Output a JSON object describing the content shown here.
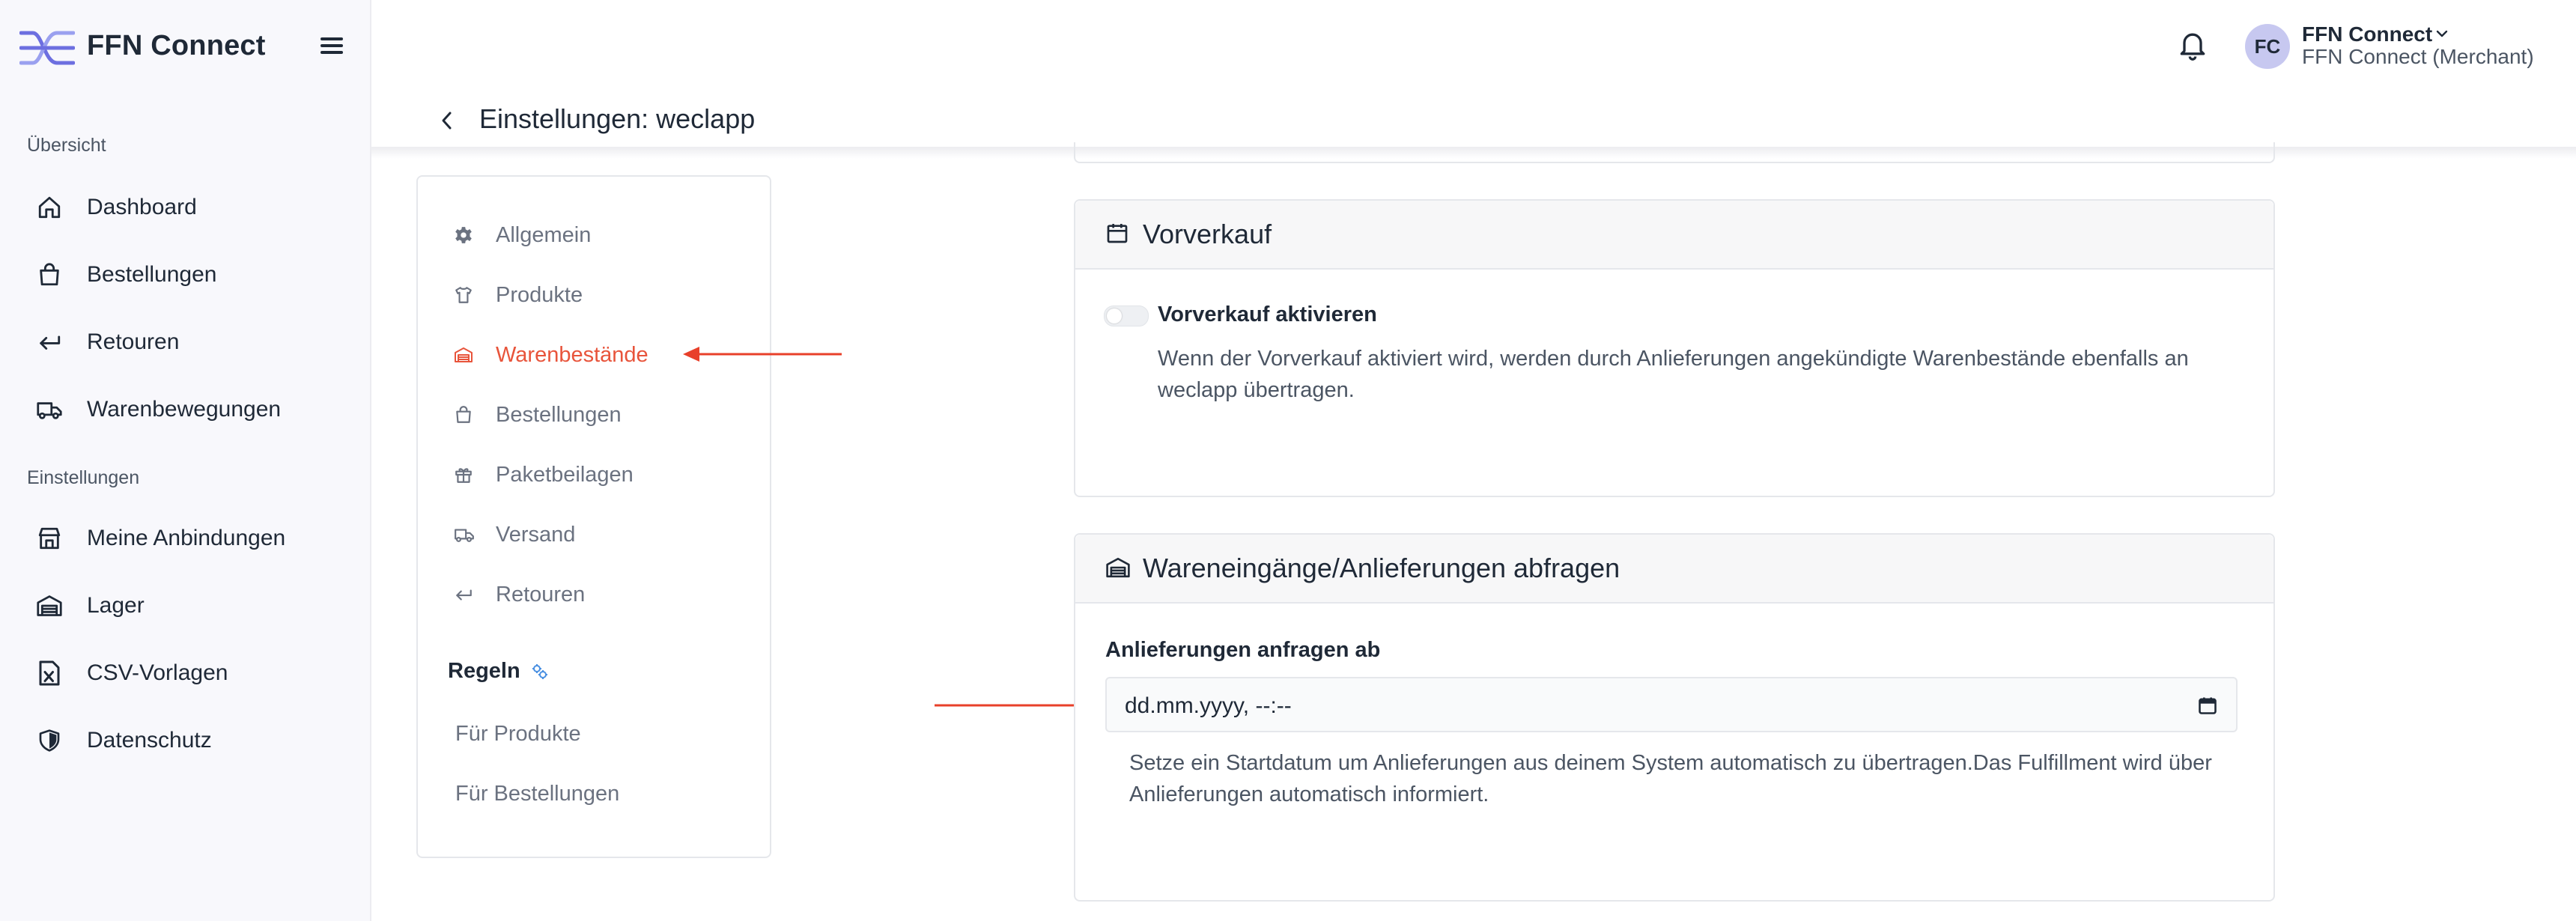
{
  "brand": {
    "name": "FFN Connect"
  },
  "sidebar": {
    "sections": [
      {
        "label": "Übersicht",
        "items": [
          {
            "label": "Dashboard",
            "icon": "home-icon"
          },
          {
            "label": "Bestellungen",
            "icon": "shopping-bag-icon"
          },
          {
            "label": "Retouren",
            "icon": "return-arrow-icon"
          },
          {
            "label": "Warenbewegungen",
            "icon": "truck-icon"
          }
        ]
      },
      {
        "label": "Einstellungen",
        "items": [
          {
            "label": "Meine Anbindungen",
            "icon": "store-icon"
          },
          {
            "label": "Lager",
            "icon": "warehouse-icon"
          },
          {
            "label": "CSV-Vorlagen",
            "icon": "csv-file-icon"
          },
          {
            "label": "Datenschutz",
            "icon": "shield-icon"
          }
        ]
      }
    ]
  },
  "header": {
    "account": {
      "initials": "FC",
      "name": "FFN Connect",
      "role": "FFN Connect (Merchant)"
    },
    "page_title": "Einstellungen: weclapp"
  },
  "settings_menu": {
    "items": [
      {
        "label": "Allgemein",
        "icon": "gear-icon",
        "active": false
      },
      {
        "label": "Produkte",
        "icon": "shirt-icon",
        "active": false
      },
      {
        "label": "Warenbestände",
        "icon": "warehouse-icon",
        "active": true
      },
      {
        "label": "Bestellungen",
        "icon": "shopping-bag-icon",
        "active": false
      },
      {
        "label": "Paketbeilagen",
        "icon": "gift-icon",
        "active": false
      },
      {
        "label": "Versand",
        "icon": "truck-icon",
        "active": false
      },
      {
        "label": "Retouren",
        "icon": "return-arrow-icon",
        "active": false
      }
    ],
    "rules": {
      "title": "Regeln",
      "items": [
        {
          "label": "Für Produkte"
        },
        {
          "label": "Für Bestellungen"
        }
      ]
    }
  },
  "presale_card": {
    "title": "Vorverkauf",
    "toggle_label": "Vorverkauf aktivieren",
    "toggle_on": false,
    "description_lines": [
      "Wenn der Vorverkauf aktiviert wird, werden durch Anlieferungen angekündigte Warenbestände ebenfalls an",
      "weclapp übertragen."
    ]
  },
  "inbound_card": {
    "title": "Wareneingänge/Anlieferungen abfragen",
    "field_label": "Anlieferungen anfragen ab",
    "date_placeholder": "dd.mm.yyyy, --:--",
    "help_lines": [
      "Setze ein Startdatum um Anlieferungen aus deinem System automatisch zu übertragen.Das Fulfillment wird über",
      "Anlieferungen automatisch informiert."
    ]
  },
  "colors": {
    "accent": "#e8543b",
    "brand_logo": "#6d6fe0",
    "annotation_arrow": "#e8402a"
  }
}
